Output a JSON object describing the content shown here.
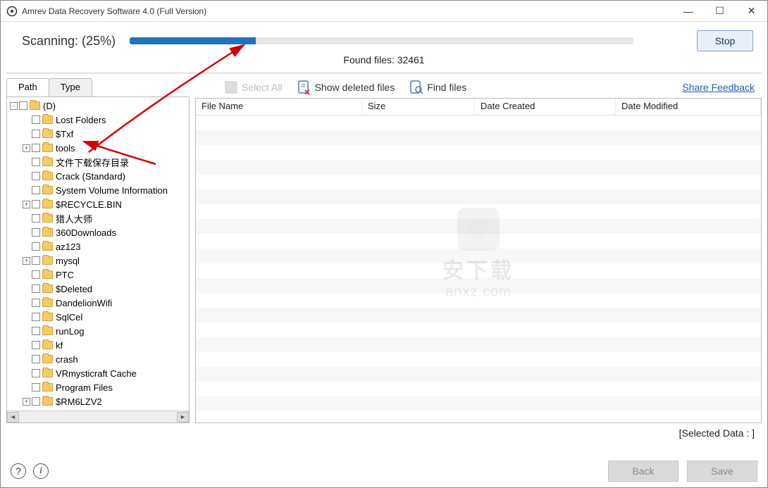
{
  "window": {
    "title": "Amrev Data Recovery Software 4.0 (Full Version)"
  },
  "scan": {
    "label": "Scanning: (25%)",
    "progress_pct": 25,
    "found_label": "Found files: 32461",
    "stop_label": "Stop"
  },
  "tabs": {
    "path": "Path",
    "type": "Type"
  },
  "tree": [
    {
      "label": "(D)",
      "level": 0,
      "expander": "-"
    },
    {
      "label": "Lost Folders",
      "level": 1,
      "expander": ""
    },
    {
      "label": "$Txf",
      "level": 1,
      "expander": ""
    },
    {
      "label": "tools",
      "level": 1,
      "expander": "+"
    },
    {
      "label": "文件下载保存目录",
      "level": 1,
      "expander": ""
    },
    {
      "label": "Crack (Standard)",
      "level": 1,
      "expander": ""
    },
    {
      "label": "System Volume Information",
      "level": 1,
      "expander": ""
    },
    {
      "label": "$RECYCLE.BIN",
      "level": 1,
      "expander": "+"
    },
    {
      "label": "猎人大师",
      "level": 1,
      "expander": ""
    },
    {
      "label": "360Downloads",
      "level": 1,
      "expander": ""
    },
    {
      "label": "az123",
      "level": 1,
      "expander": ""
    },
    {
      "label": "mysql",
      "level": 1,
      "expander": "+"
    },
    {
      "label": "PTC",
      "level": 1,
      "expander": ""
    },
    {
      "label": "$Deleted",
      "level": 1,
      "expander": ""
    },
    {
      "label": "DandelionWifi",
      "level": 1,
      "expander": ""
    },
    {
      "label": "SqlCel",
      "level": 1,
      "expander": ""
    },
    {
      "label": "runLog",
      "level": 1,
      "expander": ""
    },
    {
      "label": "kf",
      "level": 1,
      "expander": ""
    },
    {
      "label": "crash",
      "level": 1,
      "expander": ""
    },
    {
      "label": "VRmysticraft Cache",
      "level": 1,
      "expander": ""
    },
    {
      "label": "Program Files",
      "level": 1,
      "expander": ""
    },
    {
      "label": "$RM6LZV2",
      "level": 1,
      "expander": "+"
    }
  ],
  "toolbar": {
    "select_all": "Select All",
    "show_deleted": "Show deleted files",
    "find_files": "Find files",
    "feedback": "Share Feedback"
  },
  "columns": {
    "file_name": "File Name",
    "size": "Size",
    "date_created": "Date Created",
    "date_modified": "Date Modified"
  },
  "watermark": {
    "line1": "安下载",
    "line2": "anxz.com"
  },
  "footer": {
    "selected": "[Selected Data : ]",
    "back": "Back",
    "save": "Save"
  }
}
